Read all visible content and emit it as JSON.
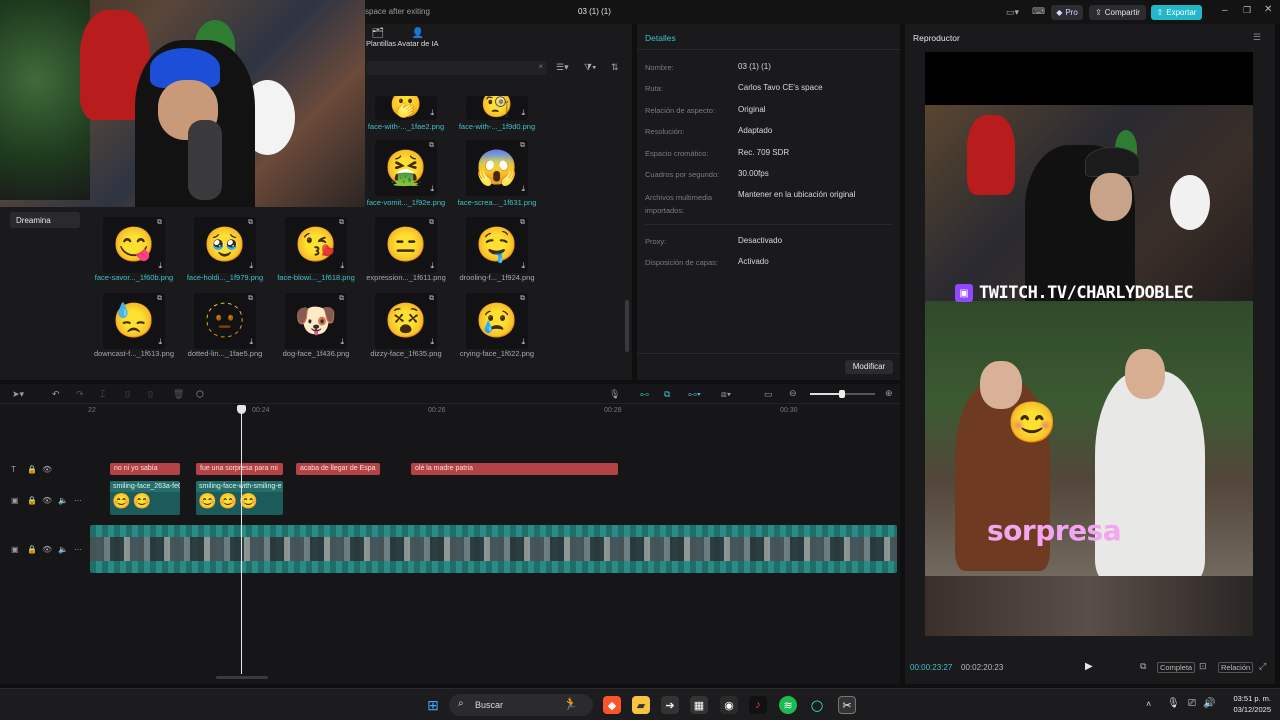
{
  "titlebar": {
    "project_hint": "space after exiting",
    "project_title": "03 (1) (1)",
    "pro_label": "Pro",
    "share_label": "Compartir",
    "export_label": "Exportar"
  },
  "media": {
    "tabs": [
      {
        "label": "Plantillas",
        "icon": "template-icon"
      },
      {
        "label": "Avatar de IA",
        "icon": "avatar-icon"
      }
    ],
    "sidebar_item": "Dreamina",
    "items": [
      {
        "name": "face-with-..._1fae2.png",
        "emoji": "🫢",
        "highlight": true
      },
      {
        "name": "face-with-..._1f9d0.png",
        "emoji": "🧐",
        "highlight": true
      },
      {
        "name": "face-vomit..._1f92e.png",
        "emoji": "🤮",
        "highlight": true
      },
      {
        "name": "face-screa..._1f631.png",
        "emoji": "😱",
        "highlight": true
      },
      {
        "name": "face-savor..._1f60b.png",
        "emoji": "😋",
        "highlight": true
      },
      {
        "name": "face-holdi..._1f979.png",
        "emoji": "🥹",
        "highlight": true
      },
      {
        "name": "face-blowi..._1f618.png",
        "emoji": "😘",
        "highlight": true
      },
      {
        "name": "expression..._1f611.png",
        "emoji": "😑",
        "highlight": false
      },
      {
        "name": "drooling-f..._1f924.png",
        "emoji": "🤤",
        "highlight": false
      },
      {
        "name": "downcast-f..._1f613.png",
        "emoji": "😓",
        "highlight": false
      },
      {
        "name": "dotted-lin..._1fae5.png",
        "emoji": "🫥",
        "highlight": false
      },
      {
        "name": "dog-face_1f436.png",
        "emoji": "🐶",
        "highlight": false
      },
      {
        "name": "dizzy-face_1f635.png",
        "emoji": "😵",
        "highlight": false
      },
      {
        "name": "crying-face_1f622.png",
        "emoji": "😢",
        "highlight": false
      }
    ]
  },
  "details": {
    "title": "Detalles",
    "rows": [
      {
        "k": "Nombre:",
        "v": "03 (1) (1)"
      },
      {
        "k": "Ruta:",
        "v": "Carlos Tavo CE's space"
      },
      {
        "k": "Relación de aspecto:",
        "v": "Original"
      },
      {
        "k": "Resolución:",
        "v": "Adaptado"
      },
      {
        "k": "Espacio cromático:",
        "v": "Rec. 709 SDR"
      },
      {
        "k": "Cuadros por segundo:",
        "v": "30.00fps"
      },
      {
        "k": "Archivos multimedia importados:",
        "v": "Mantener en la ubicación original"
      },
      {
        "k": "Proxy:",
        "v": "Desactivado"
      },
      {
        "k": "Disposición de capas:",
        "v": "Activado"
      }
    ],
    "modify_label": "Modificar"
  },
  "player": {
    "title": "Reproductor",
    "overlay_text": "TWITCH.TV/CHARLYDOBLEC",
    "caption": "sorpresa",
    "current_time": "00:00:23:27",
    "total_time": "00:02:20:23",
    "full_label": "Completa",
    "ratio_label": "Relación"
  },
  "timeline": {
    "ticks": [
      "22",
      "00:24",
      "00:26",
      "00:28",
      "00:30"
    ],
    "text_clips": [
      "no ni yo sabía",
      "fue una sorpresa para mi",
      "acaba de llegar de Espa",
      "olé la madre patria"
    ],
    "sticker_clips": [
      "smiling-face_263a-fe0",
      "smiling-face-with-smiling-e"
    ]
  },
  "taskbar": {
    "search_placeholder": "Buscar",
    "time": "03:51 p. m.",
    "date": "03/12/2025"
  }
}
